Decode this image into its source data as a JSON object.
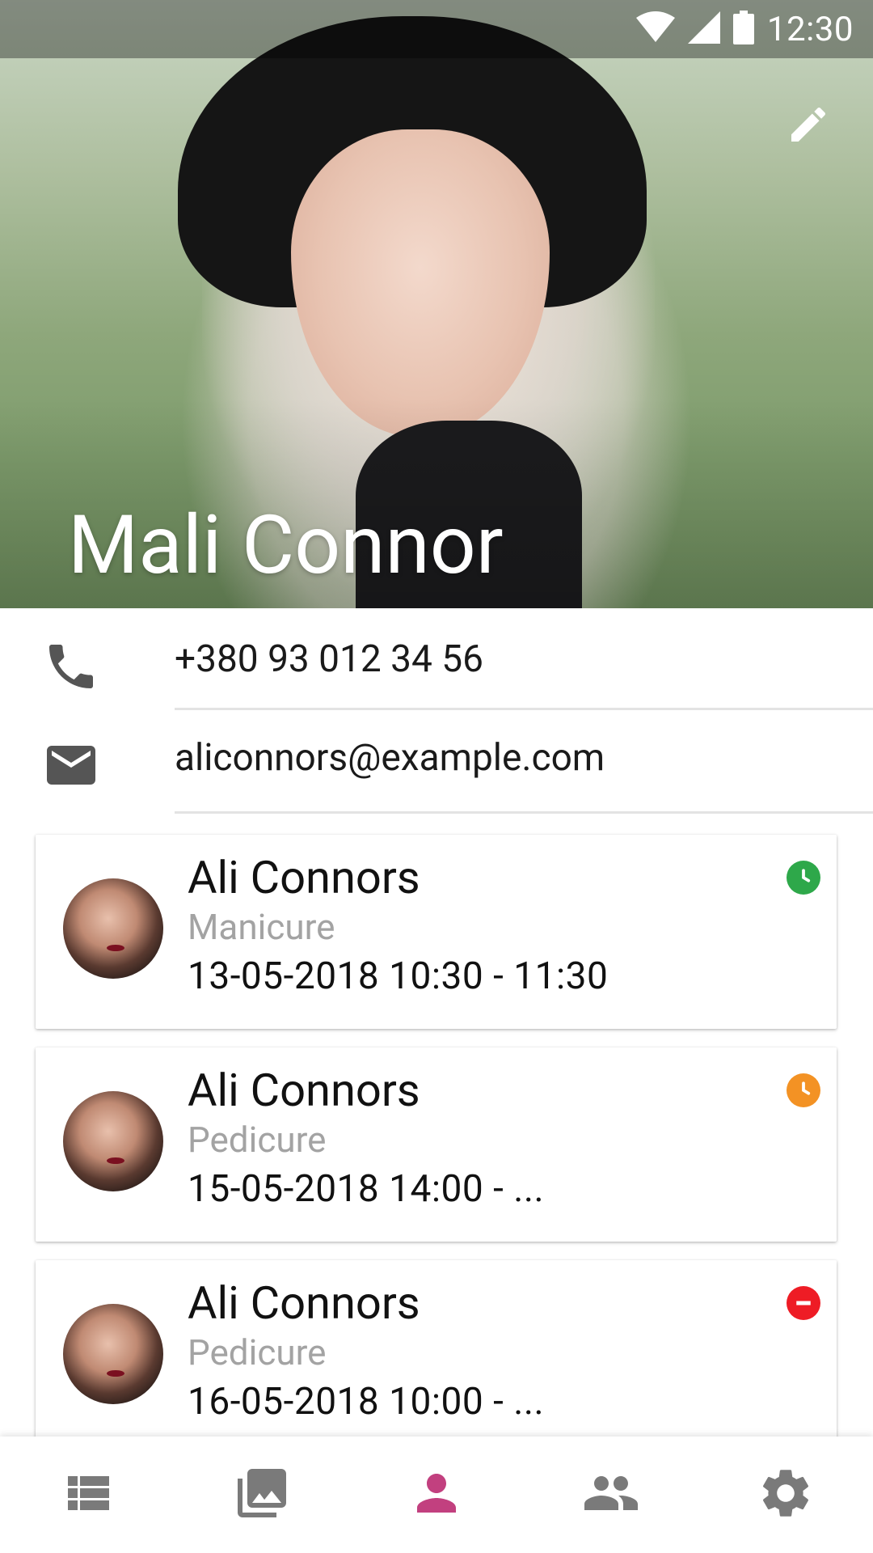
{
  "status_bar": {
    "time": "12:30",
    "icons": [
      "wifi-icon",
      "signal-icon",
      "battery-icon"
    ]
  },
  "profile": {
    "name": "Mali Connor",
    "edit_icon": "edit-icon"
  },
  "contacts": {
    "phone": {
      "icon": "phone-icon",
      "value": "+380 93 012 34 56"
    },
    "email": {
      "icon": "mail-icon",
      "value": "aliconnors@example.com"
    }
  },
  "appointments": [
    {
      "name": "Ali Connors",
      "service": "Manicure",
      "time": "13-05-2018 10:30 - 11:30",
      "status_icon": "clock-icon",
      "status_color": "#2ea84a"
    },
    {
      "name": "Ali Connors",
      "service": "Pedicure",
      "time": "15-05-2018 14:00 - ...",
      "status_icon": "clock-icon",
      "status_color": "#f39224"
    },
    {
      "name": "Ali Connors",
      "service": "Pedicure",
      "time": "16-05-2018 10:00 - ...",
      "status_icon": "minus-circle-icon",
      "status_color": "#ee1c25"
    }
  ],
  "bottom_nav": {
    "items": [
      "list-icon",
      "gallery-icon",
      "person-icon",
      "group-icon",
      "settings-icon"
    ],
    "active": "person-icon",
    "active_color": "#c2407f",
    "inactive_color": "#7a7a7a"
  }
}
